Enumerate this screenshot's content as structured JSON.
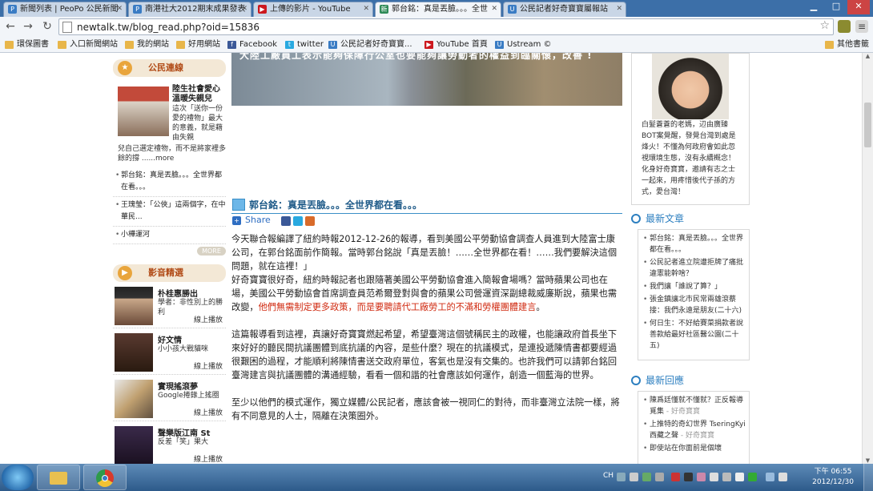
{
  "tabs": [
    {
      "label": "新聞列表 | PeoPo 公民新聞",
      "favicon": "P",
      "color": "#3a7cc4"
    },
    {
      "label": "南港社大2012期末成果發表",
      "favicon": "P",
      "color": "#3a7cc4"
    },
    {
      "label": "上傳的影片 - YouTube",
      "favicon": "▶",
      "color": "#cc181e"
    },
    {
      "label": "郭台銘：真是丟臉。。。全世",
      "favicon": "新",
      "color": "#2e8b57"
    },
    {
      "label": "公民記者好奇寶寶屬報站",
      "favicon": "U",
      "color": "#3a7cc4"
    }
  ],
  "address_bar": {
    "url": "newtalk.tw/blog_read.php?oid=15836"
  },
  "bookmarks": [
    {
      "label": "環保圖書",
      "icon": "folder"
    },
    {
      "label": "入口新聞網站",
      "icon": "folder"
    },
    {
      "label": "我的網站",
      "icon": "folder"
    },
    {
      "label": "好用網站",
      "icon": "folder"
    },
    {
      "label": "Facebook",
      "icon": "fb"
    },
    {
      "label": "twitter",
      "icon": "tw"
    },
    {
      "label": "公民記者好奇寶寶...",
      "icon": "u"
    },
    {
      "label": "YouTube 首頁",
      "icon": "yt"
    },
    {
      "label": "Ustream ©",
      "icon": "u"
    }
  ],
  "other_bookmarks": "其他書籤",
  "left": {
    "citizen_header": "公民連線",
    "feature": {
      "title": "陸生社會愛心溫暖失親兒",
      "desc": "這次「送你一份愛的禮物」最大的意義，就是藉由失親",
      "desc2": "兒自己選定禮物，而不是將家裡多餘的撐 ......more"
    },
    "list": [
      "郭台銘：真是丟臉。。。全世界都在看。。。",
      "王瑰瑩：「公俠」這兩個字，在中華民...",
      "小樺運河"
    ],
    "more": "MORE",
    "video_header": "影音精選",
    "videos": [
      {
        "title": "朴桂惠勝出",
        "desc": "學者：非性別上的勝利",
        "play": "線上播放"
      },
      {
        "title": "好文情",
        "desc": "小小孩大戰貓咪",
        "play": "線上播放"
      },
      {
        "title": "實現搖滾夢",
        "desc": "Google捲錄上搖圈",
        "play": "線上播放"
      },
      {
        "title": "聲樂版江南 St",
        "desc": "反差「笑」果大",
        "play": "線上播放"
      }
    ]
  },
  "article": {
    "banner_text": "大陸工廠員工表示能夠保障行公室也要能夠讓勞動者的權益到臨關懷，改善 !",
    "title": "郭台銘：真是丟臉。。。全世界都在看。。。",
    "share": "Share",
    "p1": " 今天聯合報編譯了紐約時報2012-12-26的報導，看到美國公平勞動協會調查人員進到大陸富士康公司，在郭台銘面前作簡報。當時郭台銘說「真是丟臉！……全世界都在看！……我們要解決這個問題，就在這裡！」",
    "p2a": "好奇寶寶很好奇，紐約時報記者也跟隨著美國公平勞動協會進入簡報會場嗎？當時蘋果公司也在場，美國公平勞動協會首席調查員范希爾登對與會的蘋果公司營運資深副總裁威廉斯說，蘋果也需改變，",
    "p2b": "他們無需制定更多政策，而是要聘請代工廠勞工的不滿和勞權團體建言",
    "p2c": "。",
    "p3": "這篇報導看到這裡，真讓好奇寶寶燃起希望，希望臺灣這個號稱民主的政權，也能讓政府首長坐下來好好的聽民間抗議團體到底抗議的內容，是些什麼？現在的抗議模式，是連投遞陳情書都要經過很艱困的過程，才能順利將陳情書送交政府單位，客氣也是沒有交集的。也許我們可以請郭台銘回臺灣建言與抗議團體的溝通經驗，看看一個和諧的社會應該如何運作，創造一個藍海的世界。",
    "p4": "至少以他們的模式運作，獨立媒體/公民記者，應該會被一視同仁的對待，而非臺灣立法院一樣，將有不同意見的人士，隔離在決策圈外。"
  },
  "right": {
    "profile_desc": "白髮蒼蒼的老媽，辺由廣臻BOT案覺醒，發覺台灣到處是烽火！不懂為何政府會如此忽視環境生態，沒有永續概念！化身好奇寶寶，邀請有志之士一起來，用疼惜後代子孫的方式，愛台灣！",
    "latest_articles_header": "最新文章",
    "latest_articles": [
      "郭台銘：真是丟臉。。。全世界都在看。。。",
      "公民記者進立院遭拒牌了痛批違憲能幹啥？",
      "我們讓「誰說了算？」",
      "張金鎮讓北市民常兩雄滾蔡接：我們永遠是朋友(二十六)",
      "何日生：不好給賽菜捐款者說善款給最好社區醫公園(二十五)"
    ],
    "latest_replies_header": "最新回應",
    "latest_replies": [
      {
        "text": "陳爲廷懂就不懂就？正反報導覓集",
        "by": "- 好奇寶寶"
      },
      {
        "text": "上推特的奇幻世界 TseringKyi西藏之聲",
        "by": "- 好奇寶寶"
      },
      {
        "text": "即使站在你面前是個壞",
        "by": ""
      }
    ]
  },
  "taskbar": {
    "lang": "CH",
    "time": "下午 06:55",
    "date": "2012/12/30"
  }
}
